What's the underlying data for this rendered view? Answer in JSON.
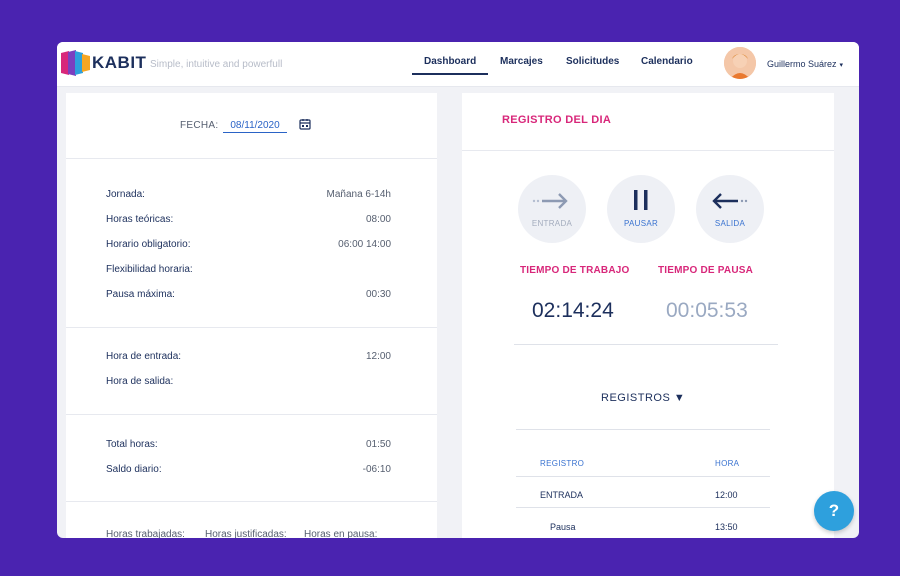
{
  "header": {
    "brand": "KABIT",
    "tagline": "Simple, intuitive and powerfull",
    "nav": [
      "Dashboard",
      "Marcajes",
      "Solicitudes",
      "Calendario"
    ],
    "active_nav": "Dashboard",
    "user_name": "Guillermo Suárez",
    "user_caret": "▾"
  },
  "left": {
    "fecha_label": "FECHA:",
    "fecha_value": "08/11/2020",
    "jornada": [
      {
        "label": "Jornada:",
        "value": "Mañana 6-14h"
      },
      {
        "label": "Horas teóricas:",
        "value": "08:00"
      },
      {
        "label": "Horario obligatorio:",
        "value": "06:00 14:00"
      },
      {
        "label": "Flexibilidad horaria:",
        "value": ""
      },
      {
        "label": "Pausa máxima:",
        "value": "00:30"
      }
    ],
    "horas": [
      {
        "label": "Hora de entrada:",
        "value": "12:00"
      },
      {
        "label": "Hora de salida:",
        "value": ""
      }
    ],
    "totales": [
      {
        "label": "Total horas:",
        "value": "01:50"
      },
      {
        "label": "Saldo diario:",
        "value": "-06:10"
      }
    ],
    "bottom": [
      "Horas trabajadas:",
      "Horas justificadas:",
      "Horas en pausa:"
    ]
  },
  "right": {
    "title": "REGISTRO DEL DIA",
    "buttons": {
      "entrada": "ENTRADA",
      "pausar": "PAUSAR",
      "salida": "SALIDA"
    },
    "tiempo_trabajo_label": "TIEMPO DE TRABAJO",
    "tiempo_trabajo": "02:14:24",
    "tiempo_pausa_label": "TIEMPO DE PAUSA",
    "tiempo_pausa": "00:05:53",
    "registros_label": "REGISTROS ▼",
    "table": {
      "headers": [
        "REGISTRO",
        "HORA"
      ],
      "rows": [
        {
          "registro": "ENTRADA",
          "hora": "12:00"
        },
        {
          "registro": "Pausa",
          "hora": "13:50"
        }
      ]
    }
  },
  "help_label": "?",
  "colors": {
    "background": "#4a23b0",
    "accent_pink": "#d8277a",
    "navy": "#1c2f5c",
    "link_blue": "#2a63c6",
    "help_blue": "#2ea0dd"
  }
}
